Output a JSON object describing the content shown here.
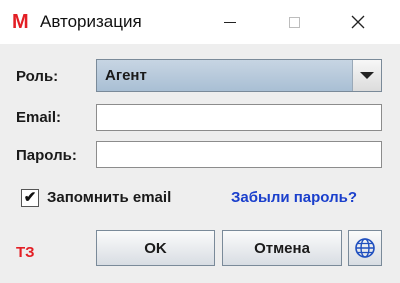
{
  "window": {
    "app_icon_letter": "M",
    "title": "Авторизация"
  },
  "form": {
    "role_label": "Роль:",
    "role_value": "Агент",
    "email_label": "Email:",
    "email_value": "",
    "password_label": "Пароль:",
    "password_value": "",
    "remember_checked_glyph": "✔",
    "remember_label": "Запомнить email",
    "forgot_link": "Забыли пароль?",
    "version_tag": "ТЗ"
  },
  "buttons": {
    "ok": "OK",
    "cancel": "Отмена",
    "language_icon": "globe-icon"
  },
  "colors": {
    "brand_red": "#e31e24",
    "link_blue": "#1a3fcc",
    "combo_blue": "#b5c8db"
  }
}
